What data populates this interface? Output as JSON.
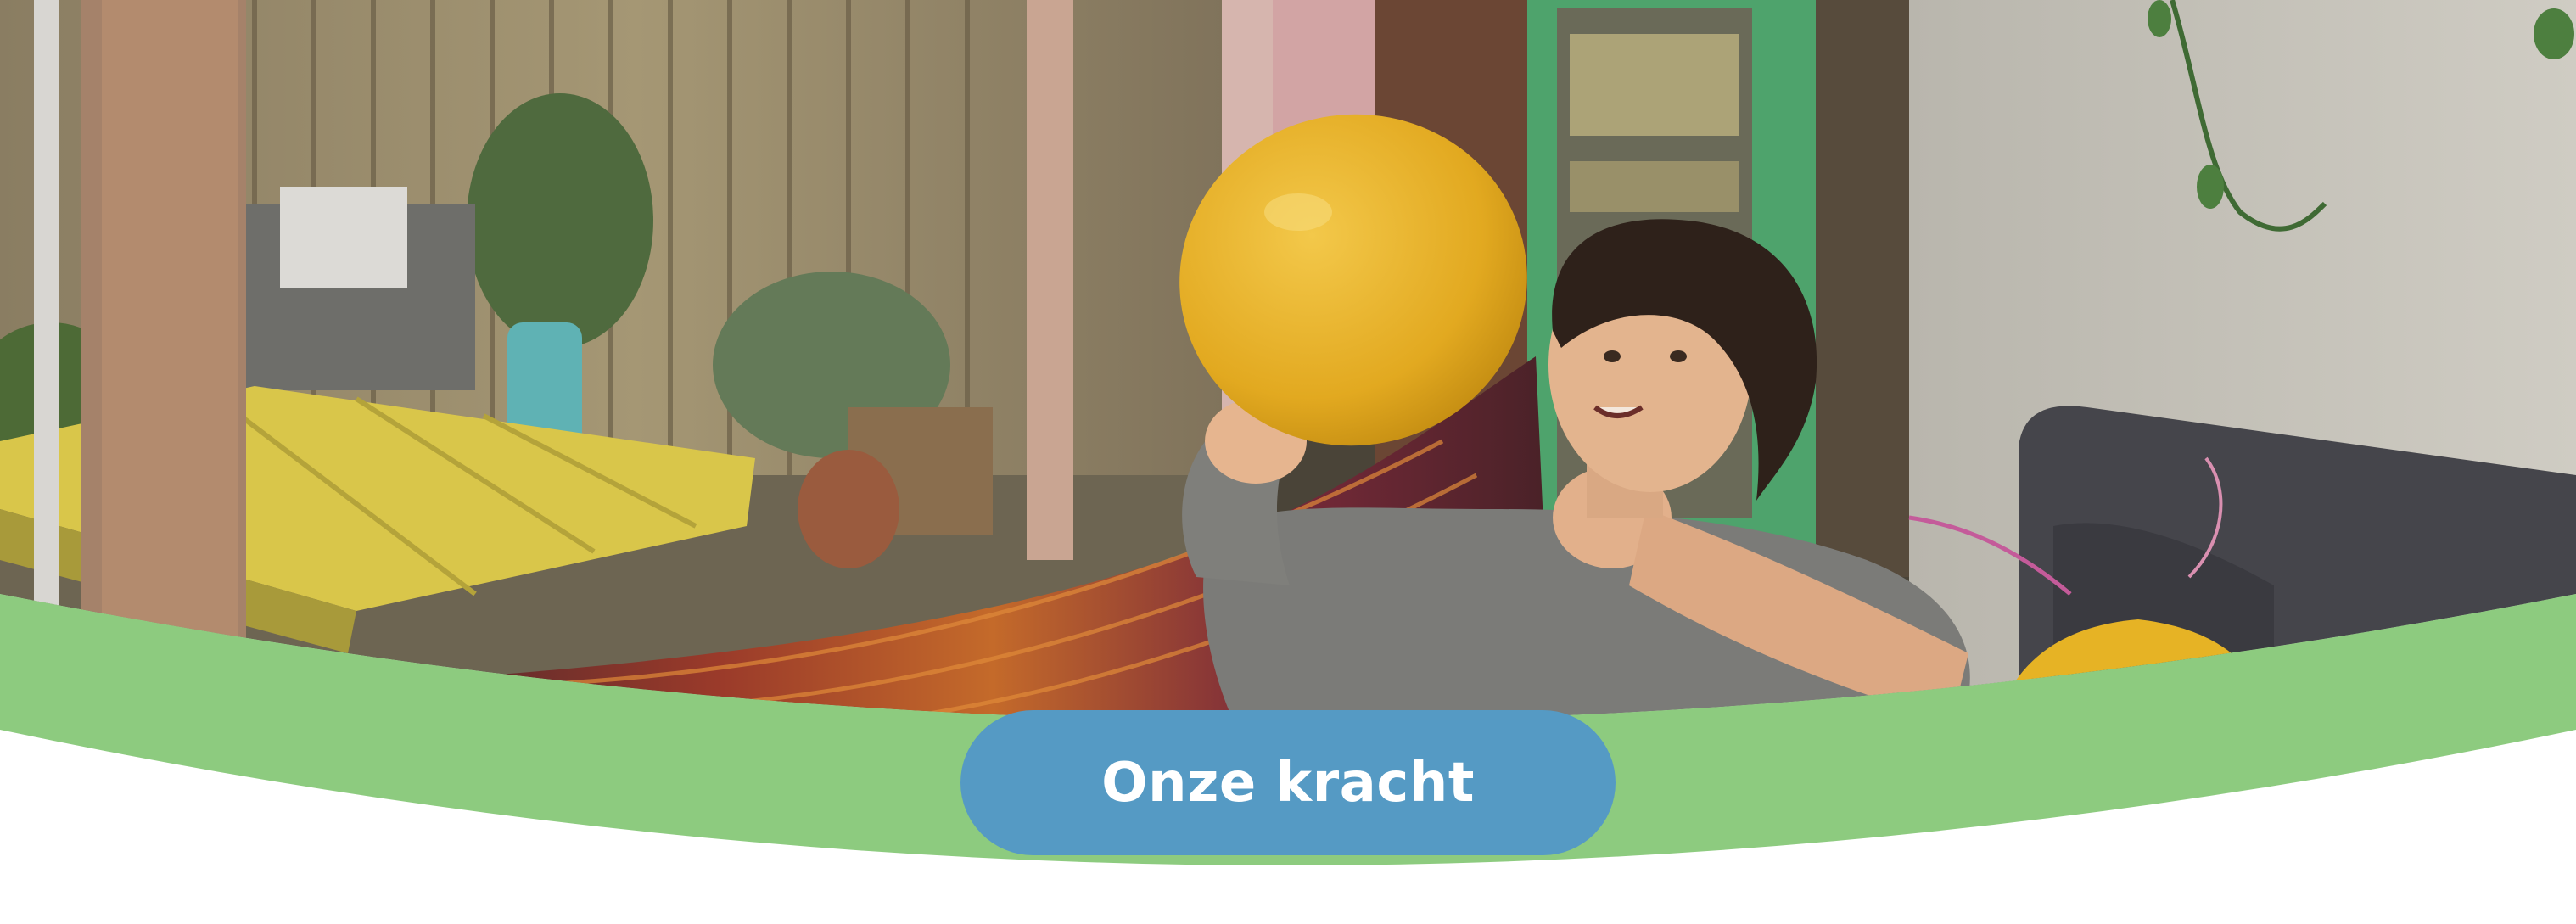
{
  "hero": {
    "cta_label": "Onze kracht",
    "photo_subject": "child-playing-with-balloon",
    "colors": {
      "banner_green": "#8dcb7f",
      "button_blue": "#559ac4",
      "button_text": "#ffffff",
      "background": "#ffffff"
    }
  }
}
